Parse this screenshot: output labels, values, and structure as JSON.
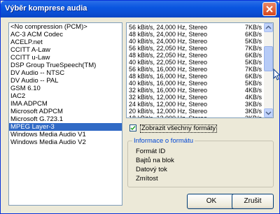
{
  "window": {
    "title": "Výběr komprese audia"
  },
  "codecs": [
    "<No compression (PCM)>",
    "AC-3 ACM Codec",
    "ACELP.net",
    "CCITT A-Law",
    "CCITT u-Law",
    "DSP Group TrueSpeech(TM)",
    "DV Audio -- NTSC",
    "DV Audio -- PAL",
    "GSM 6.10",
    "IAC2",
    "IMA ADPCM",
    "Microsoft ADPCM",
    "Microsoft G.723.1",
    "MPEG Layer-3",
    "Windows Media Audio V1",
    "Windows Media Audio V2"
  ],
  "selected_codec": "MPEG Layer-3",
  "formats": [
    {
      "format": "56 kBit/s, 24,000 Hz, Stereo",
      "rate": "7KB/s"
    },
    {
      "format": "48 kBit/s, 24,000 Hz, Stereo",
      "rate": "6KB/s"
    },
    {
      "format": "40 kBit/s, 24,000 Hz, Stereo",
      "rate": "5KB/s"
    },
    {
      "format": "56 kBit/s, 22,050 Hz, Stereo",
      "rate": "7KB/s"
    },
    {
      "format": "48 kBit/s, 22,050 Hz, Stereo",
      "rate": "6KB/s"
    },
    {
      "format": "40 kBit/s, 22,050 Hz, Stereo",
      "rate": "5KB/s"
    },
    {
      "format": "56 kBit/s, 16,000 Hz, Stereo",
      "rate": "7KB/s"
    },
    {
      "format": "48 kBit/s, 16,000 Hz, Stereo",
      "rate": "6KB/s"
    },
    {
      "format": "40 kBit/s, 16,000 Hz, Stereo",
      "rate": "5KB/s"
    },
    {
      "format": "32 kBit/s, 16,000 Hz, Stereo",
      "rate": "4KB/s"
    },
    {
      "format": "32 kBit/s, 12,000 Hz, Stereo",
      "rate": "4KB/s"
    },
    {
      "format": "24 kBit/s, 12,000 Hz, Stereo",
      "rate": "3KB/s"
    },
    {
      "format": "20 kBit/s, 12,000 Hz, Stereo",
      "rate": "3KB/s"
    },
    {
      "format": "18 kBit/s, 12,000 Hz, Stereo",
      "rate": "3KB/s"
    }
  ],
  "show_all_formats": {
    "label": "Zobrazit všechny formáty",
    "checked": true
  },
  "format_info": {
    "title": "Informace o formátu",
    "fields": [
      "Formát ID",
      "Bajtů na blok",
      "Datový tok",
      "Zmítost"
    ]
  },
  "buttons": {
    "ok": "OK",
    "cancel": "Zrušit"
  },
  "colors": {
    "selection": "#316ac5",
    "title_bar": "#0a56e0",
    "group_title": "#0046d5"
  }
}
